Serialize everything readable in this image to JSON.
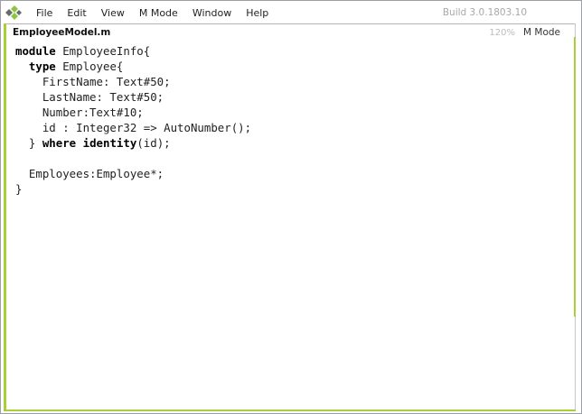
{
  "menubar": {
    "items": [
      "File",
      "Edit",
      "View",
      "M Mode",
      "Window",
      "Help"
    ],
    "build": "Build 3.0.1803.10"
  },
  "document": {
    "title": "EmployeeModel.m",
    "zoom": "120%",
    "mode": "M Mode"
  },
  "colors": {
    "accent": "#a7cf3a",
    "logo_dark": "#6b6b6b",
    "logo_green": "#8dc63f"
  },
  "code": {
    "lines": [
      [
        {
          "t": "module",
          "kw": true
        },
        {
          "t": " EmployeeInfo{"
        }
      ],
      [
        {
          "t": "  "
        },
        {
          "t": "type",
          "kw": true
        },
        {
          "t": " Employee{"
        }
      ],
      [
        {
          "t": "    FirstName: Text#50;"
        }
      ],
      [
        {
          "t": "    LastName: Text#50;"
        }
      ],
      [
        {
          "t": "    Number:Text#10;"
        }
      ],
      [
        {
          "t": "    id : Integer32 => AutoNumber();"
        }
      ],
      [
        {
          "t": "  } "
        },
        {
          "t": "where",
          "kw": true
        },
        {
          "t": " "
        },
        {
          "t": "identity",
          "kw": true
        },
        {
          "t": "(id);"
        }
      ],
      [
        {
          "t": ""
        }
      ],
      [
        {
          "t": "  Employees:Employee*;"
        }
      ],
      [
        {
          "t": "}"
        }
      ]
    ]
  }
}
